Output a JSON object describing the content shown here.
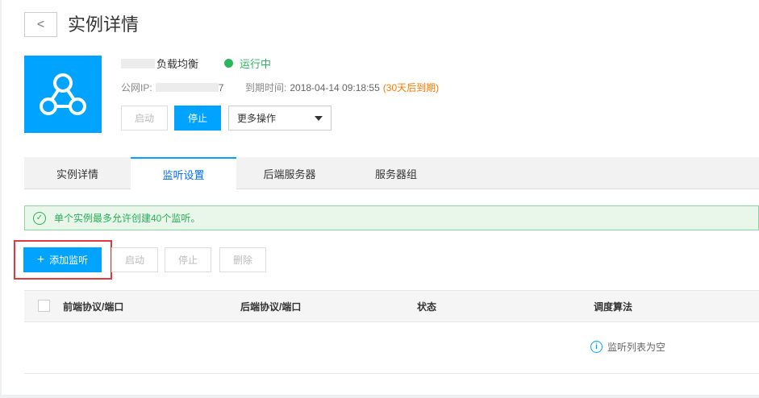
{
  "header": {
    "back_label": "<",
    "title": "实例详情"
  },
  "instance": {
    "name_suffix": "负载均衡",
    "status": "运行中",
    "status_color": "#2db55d",
    "ip_label": "公网IP:",
    "ip_suffix": "7",
    "expire_label": "到期时间:",
    "expire_value": "2018-04-14 09:18:55",
    "expire_note": "(30天后到期)",
    "icon": "network-node-icon",
    "accent": "#00a4ff"
  },
  "actions": {
    "start": "启动",
    "stop": "停止",
    "more": "更多操作"
  },
  "tabs": [
    {
      "label": "实例详情"
    },
    {
      "label": "监听设置"
    },
    {
      "label": "后端服务器"
    },
    {
      "label": "服务器组"
    }
  ],
  "notice": {
    "text": "单个实例最多允许创建40个监听。"
  },
  "toolbar": {
    "add": "添加监听",
    "start": "启动",
    "stop": "停止",
    "delete": "删除"
  },
  "table": {
    "columns": [
      "前端协议/端口",
      "后端协议/端口",
      "状态",
      "调度算法"
    ],
    "empty_text": "监听列表为空"
  }
}
